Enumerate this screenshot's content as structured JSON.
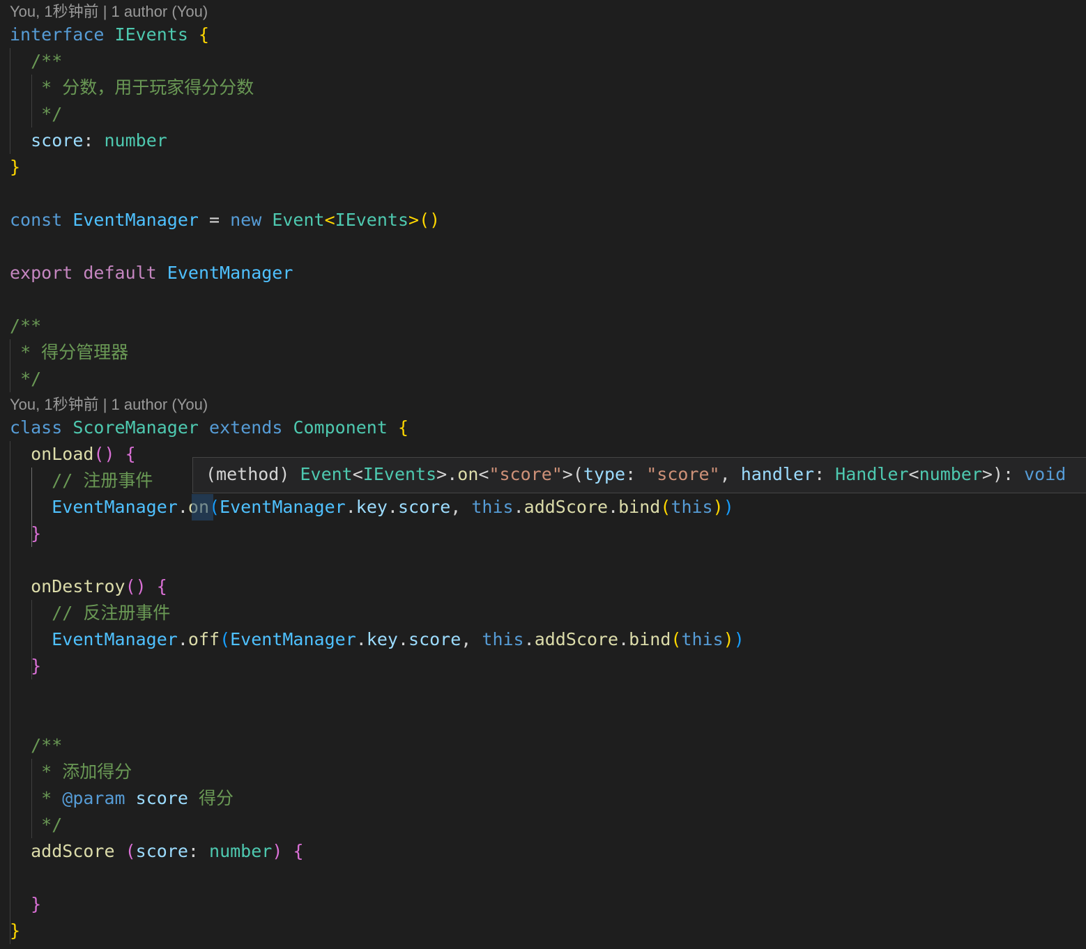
{
  "codelens": {
    "interface_lens": "You, 1秒钟前 | 1 author (You)",
    "class_lens": "You, 1秒钟前 | 1 author (You)"
  },
  "colors": {
    "background": "#1e1e1e",
    "keyword": "#569cd6",
    "control_keyword": "#c586c0",
    "type": "#4ec9b0",
    "variable": "#9cdcfe",
    "constant": "#4fc1ff",
    "function": "#dcdcaa",
    "string": "#ce9178",
    "comment": "#6a9955",
    "bracket_level1": "#ffd700",
    "bracket_level2": "#da70d6",
    "bracket_level3": "#179fff"
  },
  "lines": [
    {
      "id": "l1",
      "tokens": [
        {
          "t": "interface",
          "c": "kw"
        },
        {
          "t": " "
        },
        {
          "t": "IEvents",
          "c": "type"
        },
        {
          "t": " "
        },
        {
          "t": "{",
          "c": "b1"
        }
      ]
    },
    {
      "id": "l2",
      "tokens": [
        {
          "t": "  "
        },
        {
          "t": "/**",
          "c": "cm"
        }
      ]
    },
    {
      "id": "l3",
      "tokens": [
        {
          "t": "   "
        },
        {
          "t": "* 分数，用于玩家得分分数",
          "c": "cm"
        }
      ]
    },
    {
      "id": "l4",
      "tokens": [
        {
          "t": "   "
        },
        {
          "t": "*/",
          "c": "cm"
        }
      ]
    },
    {
      "id": "l5",
      "tokens": [
        {
          "t": "  "
        },
        {
          "t": "score",
          "c": "var"
        },
        {
          "t": ": "
        },
        {
          "t": "number",
          "c": "type"
        }
      ]
    },
    {
      "id": "l6",
      "tokens": [
        {
          "t": "}",
          "c": "b1"
        }
      ]
    },
    {
      "id": "l7",
      "tokens": []
    },
    {
      "id": "l8",
      "tokens": [
        {
          "t": "const",
          "c": "kw"
        },
        {
          "t": " "
        },
        {
          "t": "EventManager",
          "c": "const"
        },
        {
          "t": " = "
        },
        {
          "t": "new",
          "c": "kw"
        },
        {
          "t": " "
        },
        {
          "t": "Event",
          "c": "type"
        },
        {
          "t": "<",
          "c": "b1"
        },
        {
          "t": "IEvents",
          "c": "type"
        },
        {
          "t": ">",
          "c": "b1"
        },
        {
          "t": "()",
          "c": "b1"
        }
      ]
    },
    {
      "id": "l9",
      "tokens": []
    },
    {
      "id": "l10",
      "tokens": [
        {
          "t": "export",
          "c": "ctl"
        },
        {
          "t": " "
        },
        {
          "t": "default",
          "c": "ctl"
        },
        {
          "t": " "
        },
        {
          "t": "EventManager",
          "c": "const"
        }
      ]
    },
    {
      "id": "l11",
      "tokens": []
    },
    {
      "id": "l12",
      "tokens": [
        {
          "t": "/**",
          "c": "cm"
        }
      ]
    },
    {
      "id": "l13",
      "tokens": [
        {
          "t": " "
        },
        {
          "t": "* 得分管理器",
          "c": "cm"
        }
      ]
    },
    {
      "id": "l14",
      "tokens": [
        {
          "t": " "
        },
        {
          "t": "*/",
          "c": "cm"
        }
      ]
    },
    {
      "id": "l15",
      "tokens": [
        {
          "t": "class",
          "c": "kw"
        },
        {
          "t": " "
        },
        {
          "t": "ScoreManager",
          "c": "type"
        },
        {
          "t": " "
        },
        {
          "t": "extends",
          "c": "kw"
        },
        {
          "t": " "
        },
        {
          "t": "Component",
          "c": "type"
        },
        {
          "t": " "
        },
        {
          "t": "{",
          "c": "b1"
        }
      ]
    },
    {
      "id": "l16",
      "tokens": [
        {
          "t": "  "
        },
        {
          "t": "onLoad",
          "c": "fn"
        },
        {
          "t": "()",
          "c": "b2"
        },
        {
          "t": " "
        },
        {
          "t": "{",
          "c": "b2"
        }
      ]
    },
    {
      "id": "l17",
      "tokens": [
        {
          "t": "    "
        },
        {
          "t": "// 注册事件",
          "c": "cm"
        }
      ]
    },
    {
      "id": "l18",
      "tokens": [
        {
          "t": "    "
        },
        {
          "t": "EventManager",
          "c": "const"
        },
        {
          "t": "."
        },
        {
          "t": "on",
          "c": "fn"
        },
        {
          "t": "(",
          "c": "b3"
        },
        {
          "t": "EventManager",
          "c": "const"
        },
        {
          "t": "."
        },
        {
          "t": "key",
          "c": "var"
        },
        {
          "t": "."
        },
        {
          "t": "score",
          "c": "var"
        },
        {
          "t": ", "
        },
        {
          "t": "this",
          "c": "kw"
        },
        {
          "t": "."
        },
        {
          "t": "addScore",
          "c": "fn"
        },
        {
          "t": "."
        },
        {
          "t": "bind",
          "c": "fn"
        },
        {
          "t": "(",
          "c": "b1"
        },
        {
          "t": "this",
          "c": "kw"
        },
        {
          "t": ")",
          "c": "b1"
        },
        {
          "t": ")",
          "c": "b3"
        }
      ]
    },
    {
      "id": "l19",
      "tokens": [
        {
          "t": "  "
        },
        {
          "t": "}",
          "c": "b2"
        }
      ]
    },
    {
      "id": "l20",
      "tokens": []
    },
    {
      "id": "l21",
      "tokens": [
        {
          "t": "  "
        },
        {
          "t": "onDestroy",
          "c": "fn"
        },
        {
          "t": "()",
          "c": "b2"
        },
        {
          "t": " "
        },
        {
          "t": "{",
          "c": "b2"
        }
      ]
    },
    {
      "id": "l22",
      "tokens": [
        {
          "t": "    "
        },
        {
          "t": "// 反注册事件",
          "c": "cm"
        }
      ]
    },
    {
      "id": "l23",
      "tokens": [
        {
          "t": "    "
        },
        {
          "t": "EventManager",
          "c": "const"
        },
        {
          "t": "."
        },
        {
          "t": "off",
          "c": "fn"
        },
        {
          "t": "(",
          "c": "b3"
        },
        {
          "t": "EventManager",
          "c": "const"
        },
        {
          "t": "."
        },
        {
          "t": "key",
          "c": "var"
        },
        {
          "t": "."
        },
        {
          "t": "score",
          "c": "var"
        },
        {
          "t": ", "
        },
        {
          "t": "this",
          "c": "kw"
        },
        {
          "t": "."
        },
        {
          "t": "addScore",
          "c": "fn"
        },
        {
          "t": "."
        },
        {
          "t": "bind",
          "c": "fn"
        },
        {
          "t": "(",
          "c": "b1"
        },
        {
          "t": "this",
          "c": "kw"
        },
        {
          "t": ")",
          "c": "b1"
        },
        {
          "t": ")",
          "c": "b3"
        }
      ]
    },
    {
      "id": "l24",
      "tokens": [
        {
          "t": "  "
        },
        {
          "t": "}",
          "c": "b2"
        }
      ]
    },
    {
      "id": "l25",
      "tokens": []
    },
    {
      "id": "l26",
      "tokens": []
    },
    {
      "id": "l27",
      "tokens": [
        {
          "t": "  "
        },
        {
          "t": "/**",
          "c": "cm"
        }
      ]
    },
    {
      "id": "l28",
      "tokens": [
        {
          "t": "   "
        },
        {
          "t": "* 添加得分",
          "c": "cm"
        }
      ]
    },
    {
      "id": "l29",
      "tokens": [
        {
          "t": "   "
        },
        {
          "t": "* ",
          "c": "cm"
        },
        {
          "t": "@param",
          "c": "kw"
        },
        {
          "t": " "
        },
        {
          "t": "score",
          "c": "var"
        },
        {
          "t": " 得分",
          "c": "cm"
        }
      ]
    },
    {
      "id": "l30",
      "tokens": [
        {
          "t": "   "
        },
        {
          "t": "*/",
          "c": "cm"
        }
      ]
    },
    {
      "id": "l31",
      "tokens": [
        {
          "t": "  "
        },
        {
          "t": "addScore",
          "c": "fn"
        },
        {
          "t": " "
        },
        {
          "t": "(",
          "c": "b2"
        },
        {
          "t": "score",
          "c": "var"
        },
        {
          "t": ": "
        },
        {
          "t": "number",
          "c": "type"
        },
        {
          "t": ")",
          "c": "b2"
        },
        {
          "t": " "
        },
        {
          "t": "{",
          "c": "b2"
        }
      ]
    },
    {
      "id": "l32",
      "tokens": []
    },
    {
      "id": "l33",
      "tokens": [
        {
          "t": "  "
        },
        {
          "t": "}",
          "c": "b2"
        }
      ]
    },
    {
      "id": "l34",
      "tokens": [
        {
          "t": "}",
          "c": "b1"
        }
      ]
    }
  ],
  "hover": {
    "tokens": [
      {
        "t": "(method) "
      },
      {
        "t": "Event",
        "c": "type"
      },
      {
        "t": "<"
      },
      {
        "t": "IEvents",
        "c": "type"
      },
      {
        "t": ">."
      },
      {
        "t": "on",
        "c": "fn"
      },
      {
        "t": "<"
      },
      {
        "t": "\"score\"",
        "c": "str"
      },
      {
        "t": ">("
      },
      {
        "t": "type",
        "c": "var"
      },
      {
        "t": ": "
      },
      {
        "t": "\"score\"",
        "c": "str"
      },
      {
        "t": ", "
      },
      {
        "t": "handler",
        "c": "var"
      },
      {
        "t": ": "
      },
      {
        "t": "Handler",
        "c": "type"
      },
      {
        "t": "<"
      },
      {
        "t": "number",
        "c": "type"
      },
      {
        "t": ">): "
      },
      {
        "t": "void",
        "c": "kw"
      }
    ]
  }
}
